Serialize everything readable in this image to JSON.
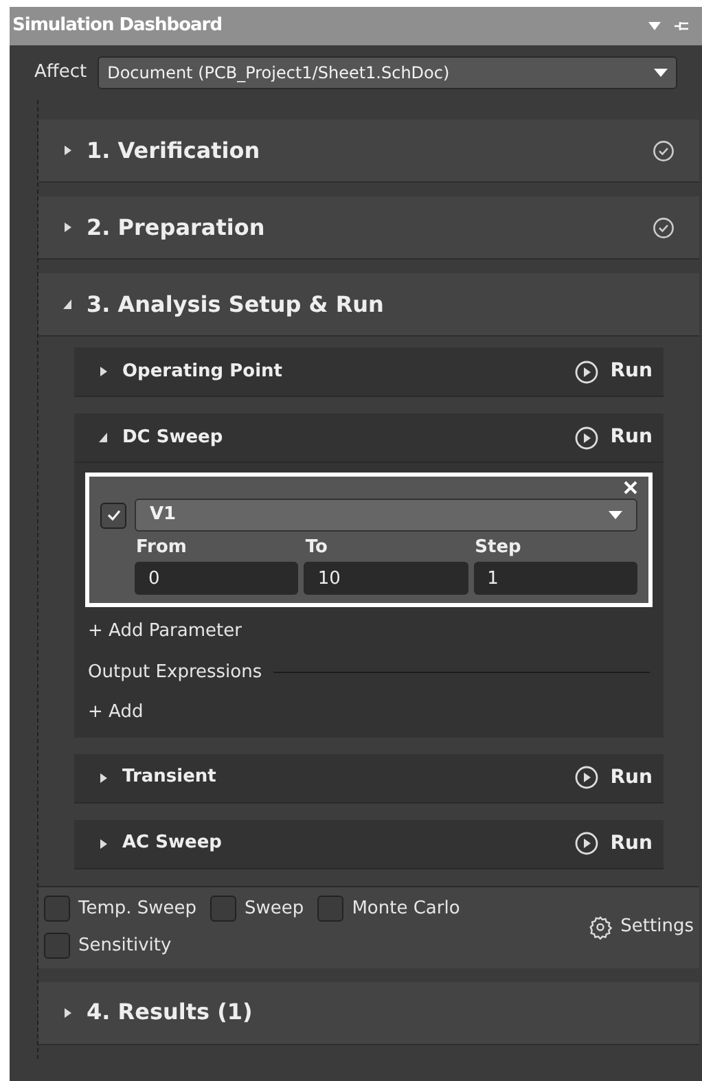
{
  "window": {
    "title": "Simulation Dashboard"
  },
  "affect": {
    "label": "Affect",
    "value": "Document (PCB_Project1/Sheet1.SchDoc)"
  },
  "sections": [
    {
      "title": "1. Verification",
      "expanded": false,
      "done": true
    },
    {
      "title": "2. Preparation",
      "expanded": false,
      "done": true
    },
    {
      "title": "3. Analysis Setup & Run",
      "expanded": true,
      "done": false,
      "analyses": [
        {
          "name": "Operating Point",
          "expanded": false,
          "run": "Run"
        },
        {
          "name": "DC Sweep",
          "expanded": true,
          "run": "Run",
          "parameter": {
            "checked": true,
            "source": "V1",
            "fields": [
              {
                "label": "From",
                "value": "0"
              },
              {
                "label": "To",
                "value": "10"
              },
              {
                "label": "Step",
                "value": "1"
              }
            ]
          },
          "add_parameter": "+ Add Parameter",
          "output_heading": "Output Expressions",
          "add_output": "+ Add"
        },
        {
          "name": "Transient",
          "expanded": false,
          "run": "Run"
        },
        {
          "name": "AC Sweep",
          "expanded": false,
          "run": "Run"
        }
      ],
      "options": [
        {
          "label": "Temp. Sweep",
          "checked": false
        },
        {
          "label": "Sweep",
          "checked": false
        },
        {
          "label": "Monte Carlo",
          "checked": false
        },
        {
          "label": "Sensitivity",
          "checked": false
        }
      ],
      "settings": "Settings"
    },
    {
      "title": "4. Results (1)",
      "expanded": false,
      "done": false
    }
  ]
}
